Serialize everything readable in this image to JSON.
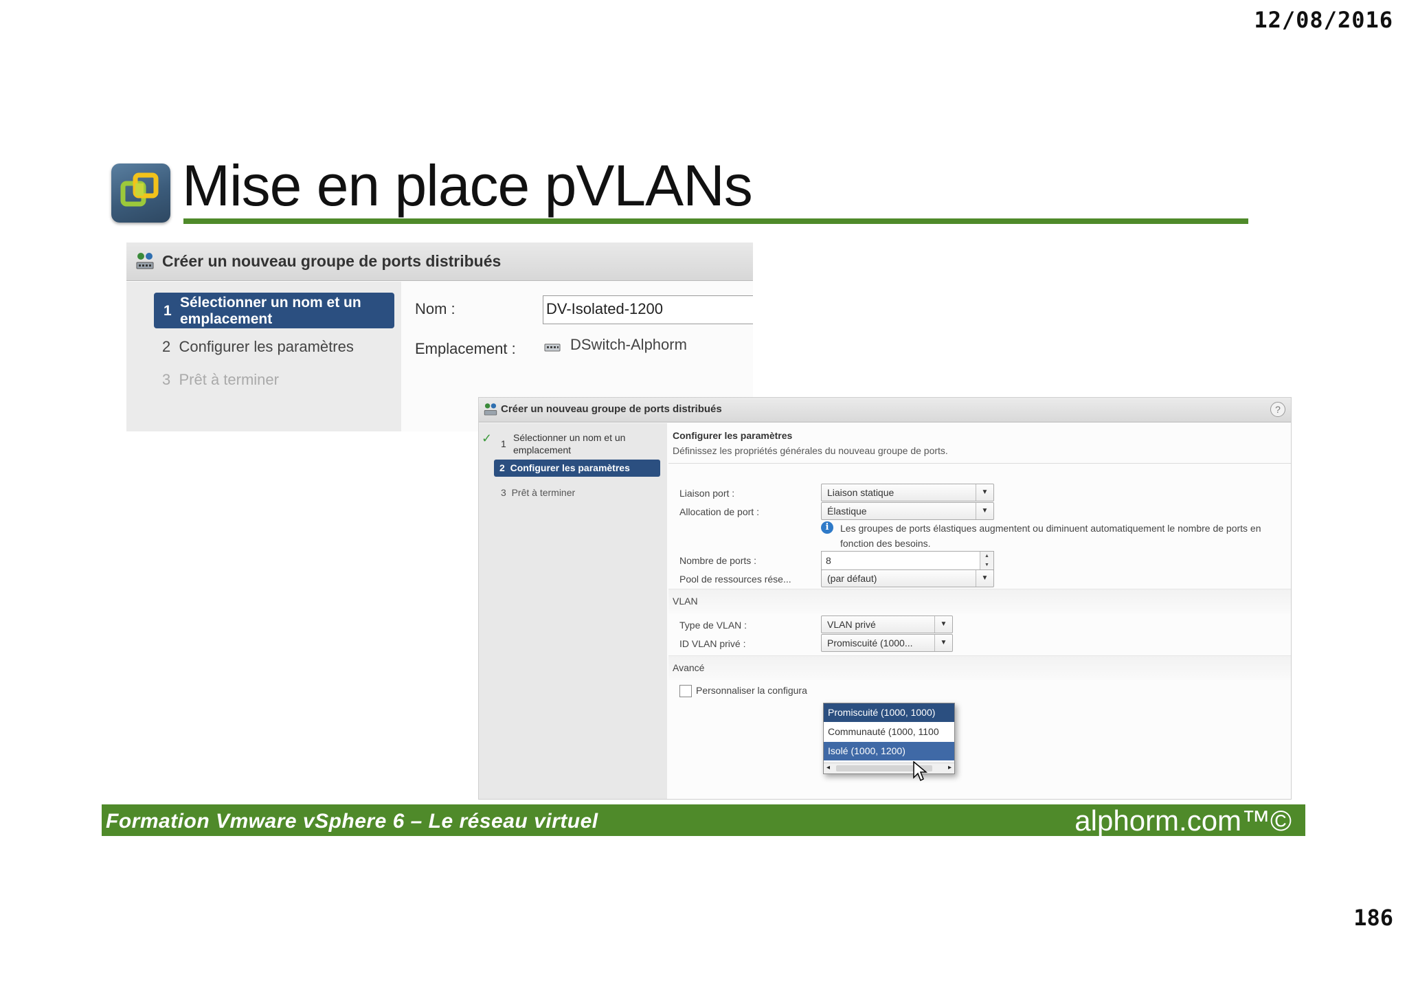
{
  "date": "12/08/2016",
  "title": "Mise en place pVLANs",
  "page_number": "186",
  "footer": {
    "course": "Formation Vmware vSphere 6 – Le réseau virtuel",
    "brand": "alphorm.com™©"
  },
  "colors": {
    "accent_green": "#4f8a2a",
    "nav_selected": "#2b4f80",
    "info_blue": "#2f7ac8"
  },
  "dialog1": {
    "title": "Créer un nouveau groupe de ports distribués",
    "steps": [
      {
        "num": "1",
        "label": "Sélectionner un nom et un emplacement"
      },
      {
        "num": "2",
        "label": "Configurer les paramètres"
      },
      {
        "num": "3",
        "label": "Prêt à terminer"
      }
    ],
    "name_label": "Nom :",
    "name_value": "DV-Isolated-1200",
    "location_label": "Emplacement :",
    "location_value": "DSwitch-Alphorm",
    "location_icon": "network-switch-icon"
  },
  "dialog2": {
    "title": "Créer un nouveau groupe de ports distribués",
    "help": "?",
    "steps": [
      {
        "num": "1",
        "label": "Sélectionner un nom et un emplacement",
        "status": "completed"
      },
      {
        "num": "2",
        "label": "Configurer les paramètres",
        "status": "active"
      },
      {
        "num": "3",
        "label": "Prêt à terminer",
        "status": "pending"
      }
    ],
    "section_title": "Configurer les paramètres",
    "section_desc": "Définissez les propriétés générales du nouveau groupe de ports.",
    "port_binding_label": "Liaison port :",
    "port_binding_value": "Liaison statique",
    "port_allocation_label": "Allocation de port :",
    "port_allocation_value": "Élastique",
    "info_text": "Les groupes de ports élastiques augmentent ou diminuent automatiquement le nombre de ports en fonction des besoins.",
    "num_ports_label": "Nombre de ports :",
    "num_ports_value": "8",
    "resource_pool_label": "Pool de ressources rése...",
    "resource_pool_value": "(par défaut)",
    "vlan_section": "VLAN",
    "vlan_type_label": "Type de VLAN :",
    "vlan_type_value": "VLAN privé",
    "pvlan_id_label": "ID VLAN privé :",
    "pvlan_id_value": "Promiscuité (1000...",
    "advanced_section": "Avancé",
    "customize_label": "Personnaliser la configura",
    "pvlan_options": [
      "Promiscuité (1000, 1000)",
      "Communauté (1000, 1100",
      "Isolé (1000, 1200)"
    ]
  }
}
